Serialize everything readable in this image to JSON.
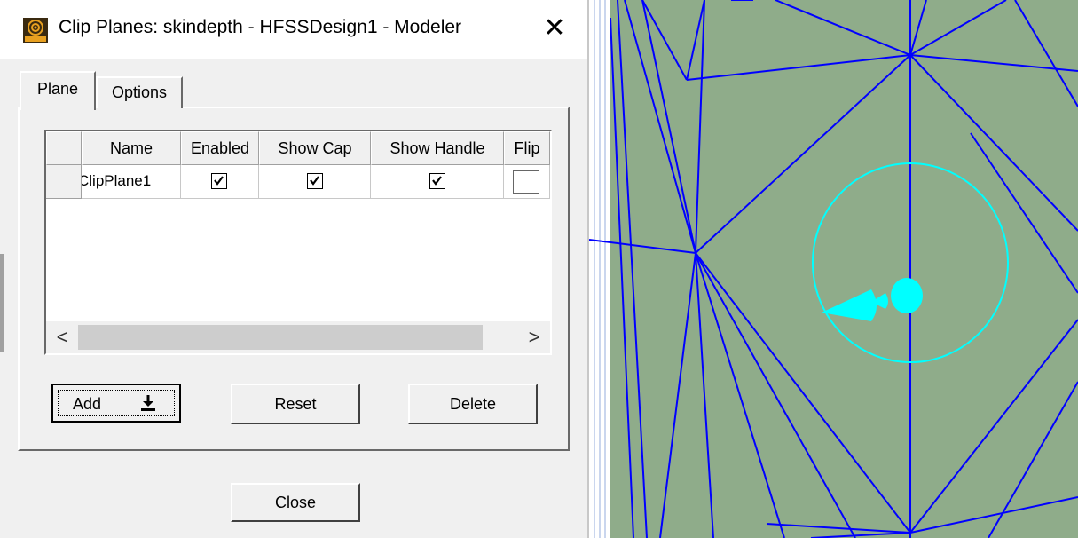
{
  "window": {
    "title": "Clip Planes: skindepth - HFSSDesign1 - Modeler",
    "app_icon": "edt-icon",
    "close_glyph": "✕"
  },
  "tabs": [
    {
      "label": "Plane",
      "selected": true
    },
    {
      "label": "Options",
      "selected": false
    }
  ],
  "grid": {
    "columns": [
      "",
      "Name",
      "Enabled",
      "Show Cap",
      "Show Handle",
      "Flip"
    ],
    "rows": [
      {
        "name": "ClipPlane1",
        "enabled": true,
        "show_cap": true,
        "show_handle": true,
        "flip": false
      }
    ],
    "scroll_left_glyph": "<",
    "scroll_right_glyph": ">"
  },
  "buttons": {
    "add": "Add",
    "reset": "Reset",
    "delete": "Delete",
    "close": "Close"
  },
  "viewport": {
    "background_color": "#8fac8a",
    "mesh_color": "#0000ff",
    "handle_color": "#00ffff"
  }
}
